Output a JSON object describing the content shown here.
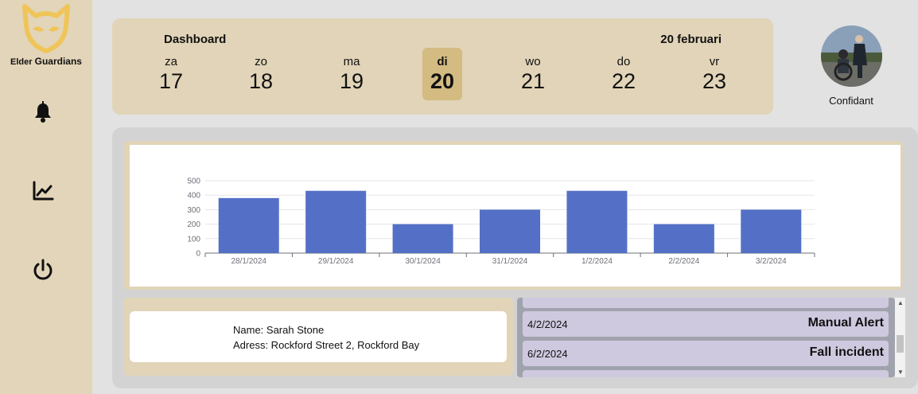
{
  "app": {
    "logo_text_1": "Elder",
    "logo_text_2": "Guardians"
  },
  "sidebar": {
    "items": [
      {
        "icon": "bell-icon"
      },
      {
        "icon": "chart-line-icon"
      },
      {
        "icon": "power-icon"
      }
    ]
  },
  "header": {
    "title": "Dashboard",
    "date": "20 februari",
    "days": [
      {
        "name": "za",
        "date": "17"
      },
      {
        "name": "zo",
        "date": "18"
      },
      {
        "name": "ma",
        "date": "19"
      },
      {
        "name": "di",
        "date": "20",
        "active": true
      },
      {
        "name": "wo",
        "date": "21"
      },
      {
        "name": "do",
        "date": "22"
      },
      {
        "name": "vr",
        "date": "23"
      }
    ]
  },
  "profile": {
    "label": "Confidant"
  },
  "colors": {
    "sidebar_bg": "#e3d5b9",
    "card_bg": "#e1d4b8",
    "active_day": "#d4bb82",
    "bar": "#5470c6",
    "alert_bg": "#cfc9df",
    "logo": "#efc55a"
  },
  "chart_data": {
    "type": "bar",
    "categories": [
      "28/1/2024",
      "29/1/2024",
      "30/1/2024",
      "31/1/2024",
      "1/2/2024",
      "2/2/2024",
      "3/2/2024"
    ],
    "values": [
      380,
      430,
      200,
      300,
      430,
      200,
      300
    ],
    "yticks": [
      0,
      100,
      200,
      300,
      400,
      500
    ],
    "ylim": [
      0,
      500
    ],
    "grid": true,
    "title": "",
    "xlabel": "",
    "ylabel": ""
  },
  "info": {
    "name": "Name: Sarah Stone",
    "address": "Adress: Rockford Street 2, Rockford Bay"
  },
  "alerts": [
    {
      "date": "",
      "type": "Manual Alert"
    },
    {
      "date": "4/2/2024",
      "type": "Manual Alert"
    },
    {
      "date": "6/2/2024",
      "type": "Fall incident"
    },
    {
      "date": "",
      "type": ""
    }
  ]
}
